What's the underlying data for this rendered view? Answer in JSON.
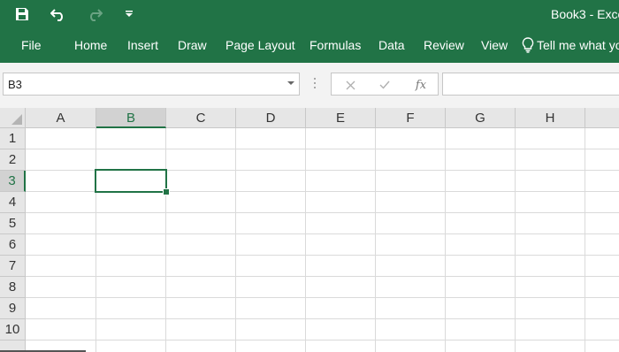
{
  "title_bar": {
    "document_title": "Book3  -  Exce",
    "qat": [
      {
        "icon": "save-icon"
      },
      {
        "icon": "undo-icon"
      },
      {
        "icon": "redo-icon",
        "enabled": false
      },
      {
        "icon": "customize-qat-icon"
      }
    ]
  },
  "ribbon": {
    "tabs": [
      {
        "label": "File"
      },
      {
        "label": "Home"
      },
      {
        "label": "Insert"
      },
      {
        "label": "Draw"
      },
      {
        "label": "Page Layout"
      },
      {
        "label": "Formulas"
      },
      {
        "label": "Data"
      },
      {
        "label": "Review"
      },
      {
        "label": "View"
      }
    ],
    "tell_me": "Tell me what yo"
  },
  "formula_bar": {
    "name_box": "B3",
    "fx_label": "fx",
    "formula_value": ""
  },
  "sheet": {
    "columns": [
      "A",
      "B",
      "C",
      "D",
      "E",
      "F",
      "G",
      "H"
    ],
    "rows": [
      "1",
      "2",
      "3",
      "4",
      "5",
      "6",
      "7",
      "8",
      "9",
      "10"
    ],
    "selected_column": "B",
    "selected_row": "3",
    "active_cell": "B3"
  },
  "colors": {
    "accent": "#217346",
    "header_bg": "#e6e6e6",
    "header_selected_bg": "#d2d2d2",
    "gridline": "#dadada"
  }
}
